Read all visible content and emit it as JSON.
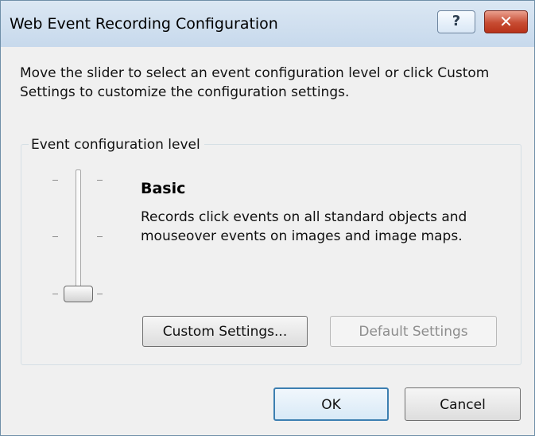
{
  "window": {
    "title": "Web Event Recording Configuration",
    "help_label": "?",
    "close_label": "✕"
  },
  "instructions": "Move the slider to select an event configuration level or click Custom Settings to customize the configuration settings.",
  "group": {
    "legend": "Event configuration level",
    "slider": {
      "levels": 3,
      "selected_index": 0
    },
    "level_title": "Basic",
    "level_description": "Records click events on all standard objects and mouseover events on images and image maps.",
    "custom_settings_label": "Custom Settings...",
    "default_settings_label": "Default Settings"
  },
  "footer": {
    "ok_label": "OK",
    "cancel_label": "Cancel"
  },
  "colors": {
    "titlebar": "#c7d9ec",
    "close_button": "#c74b32",
    "dialog_bg": "#f0f0f0"
  }
}
